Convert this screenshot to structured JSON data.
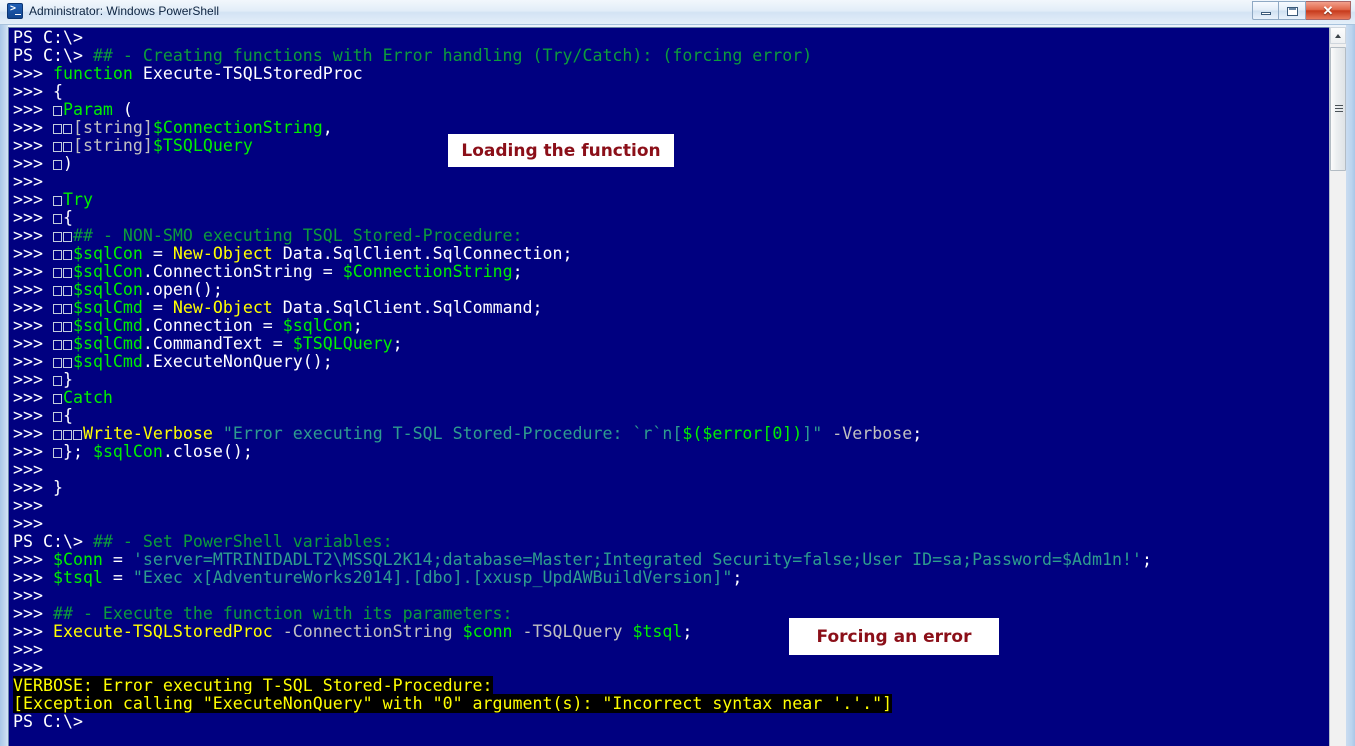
{
  "window": {
    "title": "Administrator: Windows PowerShell",
    "icon": "powershell-icon",
    "buttons": {
      "minimize": "minimize-button",
      "maximize": "maximize-button",
      "close_glyph": "✕"
    }
  },
  "console": {
    "background_color": "#000080",
    "foreground_color": "#ffffff",
    "prompt_root": "PS C:\\>",
    "prompt_continue": ">>>",
    "lines": [
      {
        "id": 1,
        "segments": [
          {
            "t": "PS C:\\>",
            "c": "white"
          }
        ]
      },
      {
        "id": 2,
        "segments": [
          {
            "t": "PS C:\\> ",
            "c": "white"
          },
          {
            "t": "## - Creating functions with Error handling (Try/Catch): (forcing error)",
            "c": "dgreen"
          }
        ]
      },
      {
        "id": 3,
        "segments": [
          {
            "t": ">>> ",
            "c": "white"
          },
          {
            "t": "function",
            "c": "green"
          },
          {
            "t": " Execute-TSQLStoredProc",
            "c": "white"
          }
        ]
      },
      {
        "id": 4,
        "segments": [
          {
            "t": ">>> ",
            "c": "white"
          },
          {
            "t": "{",
            "c": "white"
          }
        ]
      },
      {
        "id": 5,
        "segments": [
          {
            "t": ">>> ",
            "c": "white"
          },
          {
            "t": "[TAB]",
            "c": "tab"
          },
          {
            "t": "Param",
            "c": "green"
          },
          {
            "t": " (",
            "c": "white"
          }
        ]
      },
      {
        "id": 6,
        "segments": [
          {
            "t": ">>> ",
            "c": "white"
          },
          {
            "t": "[TAB][TAB]",
            "c": "tab"
          },
          {
            "t": "[string]",
            "c": "grey"
          },
          {
            "t": "$ConnectionString",
            "c": "green"
          },
          {
            "t": ",",
            "c": "white"
          }
        ]
      },
      {
        "id": 7,
        "segments": [
          {
            "t": ">>> ",
            "c": "white"
          },
          {
            "t": "[TAB][TAB]",
            "c": "tab"
          },
          {
            "t": "[string]",
            "c": "grey"
          },
          {
            "t": "$TSQLQuery",
            "c": "green"
          }
        ]
      },
      {
        "id": 8,
        "segments": [
          {
            "t": ">>> ",
            "c": "white"
          },
          {
            "t": "[TAB]",
            "c": "tab"
          },
          {
            "t": ")",
            "c": "white"
          }
        ]
      },
      {
        "id": 9,
        "segments": [
          {
            "t": ">>>",
            "c": "white"
          }
        ]
      },
      {
        "id": 10,
        "segments": [
          {
            "t": ">>> ",
            "c": "white"
          },
          {
            "t": "[TAB]",
            "c": "tab"
          },
          {
            "t": "Try",
            "c": "green"
          }
        ]
      },
      {
        "id": 11,
        "segments": [
          {
            "t": ">>> ",
            "c": "white"
          },
          {
            "t": "[TAB]",
            "c": "tab"
          },
          {
            "t": "{",
            "c": "white"
          }
        ]
      },
      {
        "id": 12,
        "segments": [
          {
            "t": ">>> ",
            "c": "white"
          },
          {
            "t": "[TAB][TAB]",
            "c": "tab"
          },
          {
            "t": "## - NON-SMO executing TSQL Stored-Procedure:",
            "c": "dgreen"
          }
        ]
      },
      {
        "id": 13,
        "segments": [
          {
            "t": ">>> ",
            "c": "white"
          },
          {
            "t": "[TAB][TAB]",
            "c": "tab"
          },
          {
            "t": "$sqlCon",
            "c": "green"
          },
          {
            "t": " = ",
            "c": "white"
          },
          {
            "t": "New-Object",
            "c": "yellow"
          },
          {
            "t": " Data.SqlClient.SqlConnection;",
            "c": "white"
          }
        ]
      },
      {
        "id": 14,
        "segments": [
          {
            "t": ">>> ",
            "c": "white"
          },
          {
            "t": "[TAB][TAB]",
            "c": "tab"
          },
          {
            "t": "$sqlCon",
            "c": "green"
          },
          {
            "t": ".ConnectionString = ",
            "c": "white"
          },
          {
            "t": "$ConnectionString",
            "c": "green"
          },
          {
            "t": ";",
            "c": "white"
          }
        ]
      },
      {
        "id": 15,
        "segments": [
          {
            "t": ">>> ",
            "c": "white"
          },
          {
            "t": "[TAB][TAB]",
            "c": "tab"
          },
          {
            "t": "$sqlCon",
            "c": "green"
          },
          {
            "t": ".open();",
            "c": "white"
          }
        ]
      },
      {
        "id": 16,
        "segments": [
          {
            "t": ">>> ",
            "c": "white"
          },
          {
            "t": "[TAB][TAB]",
            "c": "tab"
          },
          {
            "t": "$sqlCmd",
            "c": "green"
          },
          {
            "t": " = ",
            "c": "white"
          },
          {
            "t": "New-Object",
            "c": "yellow"
          },
          {
            "t": " Data.SqlClient.SqlCommand;",
            "c": "white"
          }
        ]
      },
      {
        "id": 17,
        "segments": [
          {
            "t": ">>> ",
            "c": "white"
          },
          {
            "t": "[TAB][TAB]",
            "c": "tab"
          },
          {
            "t": "$sqlCmd",
            "c": "green"
          },
          {
            "t": ".Connection = ",
            "c": "white"
          },
          {
            "t": "$sqlCon",
            "c": "green"
          },
          {
            "t": ";",
            "c": "white"
          }
        ]
      },
      {
        "id": 18,
        "segments": [
          {
            "t": ">>> ",
            "c": "white"
          },
          {
            "t": "[TAB][TAB]",
            "c": "tab"
          },
          {
            "t": "$sqlCmd",
            "c": "green"
          },
          {
            "t": ".CommandText = ",
            "c": "white"
          },
          {
            "t": "$TSQLQuery",
            "c": "green"
          },
          {
            "t": ";",
            "c": "white"
          }
        ]
      },
      {
        "id": 19,
        "segments": [
          {
            "t": ">>> ",
            "c": "white"
          },
          {
            "t": "[TAB][TAB]",
            "c": "tab"
          },
          {
            "t": "$sqlCmd",
            "c": "green"
          },
          {
            "t": ".ExecuteNonQuery();",
            "c": "white"
          }
        ]
      },
      {
        "id": 20,
        "segments": [
          {
            "t": ">>> ",
            "c": "white"
          },
          {
            "t": "[TAB]",
            "c": "tab"
          },
          {
            "t": "}",
            "c": "white"
          }
        ]
      },
      {
        "id": 21,
        "segments": [
          {
            "t": ">>> ",
            "c": "white"
          },
          {
            "t": "[TAB]",
            "c": "tab"
          },
          {
            "t": "Catch",
            "c": "green"
          }
        ]
      },
      {
        "id": 22,
        "segments": [
          {
            "t": ">>> ",
            "c": "white"
          },
          {
            "t": "[TAB]",
            "c": "tab"
          },
          {
            "t": "{",
            "c": "white"
          }
        ]
      },
      {
        "id": 23,
        "segments": [
          {
            "t": ">>> ",
            "c": "white"
          },
          {
            "t": "[TAB][TAB][TAB]",
            "c": "tab"
          },
          {
            "t": "Write-Verbose",
            "c": "yellow"
          },
          {
            "t": " ",
            "c": "white"
          },
          {
            "t": "\"Error executing T-SQL Stored-Procedure: `r`n[",
            "c": "teal"
          },
          {
            "t": "$($error[0])",
            "c": "green"
          },
          {
            "t": "]\"",
            "c": "teal"
          },
          {
            "t": " -Verbose",
            "c": "grey"
          },
          {
            "t": ";",
            "c": "white"
          }
        ]
      },
      {
        "id": 24,
        "segments": [
          {
            "t": ">>> ",
            "c": "white"
          },
          {
            "t": "[TAB]",
            "c": "tab"
          },
          {
            "t": "}; ",
            "c": "white"
          },
          {
            "t": "$sqlCon",
            "c": "green"
          },
          {
            "t": ".close();",
            "c": "white"
          }
        ]
      },
      {
        "id": 25,
        "segments": [
          {
            "t": ">>>",
            "c": "white"
          }
        ]
      },
      {
        "id": 26,
        "segments": [
          {
            "t": ">>> }",
            "c": "white"
          }
        ]
      },
      {
        "id": 27,
        "segments": [
          {
            "t": ">>>",
            "c": "white"
          }
        ]
      },
      {
        "id": 28,
        "segments": [
          {
            "t": ">>>",
            "c": "white"
          }
        ]
      },
      {
        "id": 29,
        "segments": [
          {
            "t": "PS C:\\> ",
            "c": "white"
          },
          {
            "t": "## - Set PowerShell variables:",
            "c": "dgreen"
          }
        ]
      },
      {
        "id": 30,
        "segments": [
          {
            "t": ">>> ",
            "c": "white"
          },
          {
            "t": "$Conn",
            "c": "green"
          },
          {
            "t": " = ",
            "c": "white"
          },
          {
            "t": "'server=MTRINIDADLT2\\MSSQL2K14;database=Master;Integrated Security=false;User ID=sa;Password=$Adm1n!'",
            "c": "teal"
          },
          {
            "t": ";",
            "c": "white"
          }
        ]
      },
      {
        "id": 31,
        "segments": [
          {
            "t": ">>> ",
            "c": "white"
          },
          {
            "t": "$tsql",
            "c": "green"
          },
          {
            "t": " = ",
            "c": "white"
          },
          {
            "t": "\"Exec x[AdventureWorks2014].[dbo].[xxusp_UpdAWBuildVersion]\"",
            "c": "teal"
          },
          {
            "t": ";",
            "c": "white"
          }
        ]
      },
      {
        "id": 32,
        "segments": [
          {
            "t": ">>>",
            "c": "white"
          }
        ]
      },
      {
        "id": 33,
        "segments": [
          {
            "t": ">>> ",
            "c": "white"
          },
          {
            "t": "## - Execute the function with its parameters:",
            "c": "dgreen"
          }
        ]
      },
      {
        "id": 34,
        "segments": [
          {
            "t": ">>> ",
            "c": "white"
          },
          {
            "t": "Execute-TSQLStoredProc",
            "c": "yellow"
          },
          {
            "t": " -ConnectionString",
            "c": "grey"
          },
          {
            "t": " ",
            "c": "white"
          },
          {
            "t": "$conn",
            "c": "green"
          },
          {
            "t": " -TSQLQuery",
            "c": "grey"
          },
          {
            "t": " ",
            "c": "white"
          },
          {
            "t": "$tsql",
            "c": "green"
          },
          {
            "t": ";",
            "c": "white"
          }
        ]
      },
      {
        "id": 35,
        "segments": [
          {
            "t": ">>>",
            "c": "white"
          }
        ]
      },
      {
        "id": 36,
        "segments": [
          {
            "t": ">>>",
            "c": "white"
          }
        ]
      },
      {
        "id": 37,
        "verbose": true,
        "segments": [
          {
            "t": "VERBOSE: Error executing T-SQL Stored-Procedure:",
            "c": "verbose"
          }
        ]
      },
      {
        "id": 38,
        "verbose": true,
        "segments": [
          {
            "t": "[Exception calling \"ExecuteNonQuery\" with \"0\" argument(s): \"Incorrect syntax near '.'.\"]",
            "c": "verbose"
          }
        ]
      },
      {
        "id": 39,
        "segments": [
          {
            "t": "PS C:\\>",
            "c": "white"
          }
        ]
      }
    ]
  },
  "annotations": [
    {
      "id": "loading-the-function",
      "text": "Loading the function",
      "color": "#8b0f18",
      "background": "#ffffff"
    },
    {
      "id": "forcing-an-error",
      "text": "Forcing an error",
      "color": "#8b0f18",
      "background": "#ffffff"
    }
  ],
  "scrollbar": {
    "name": "vertical-scrollbar",
    "up_arrow": "scroll-up-arrow",
    "thumb": "scroll-thumb"
  }
}
